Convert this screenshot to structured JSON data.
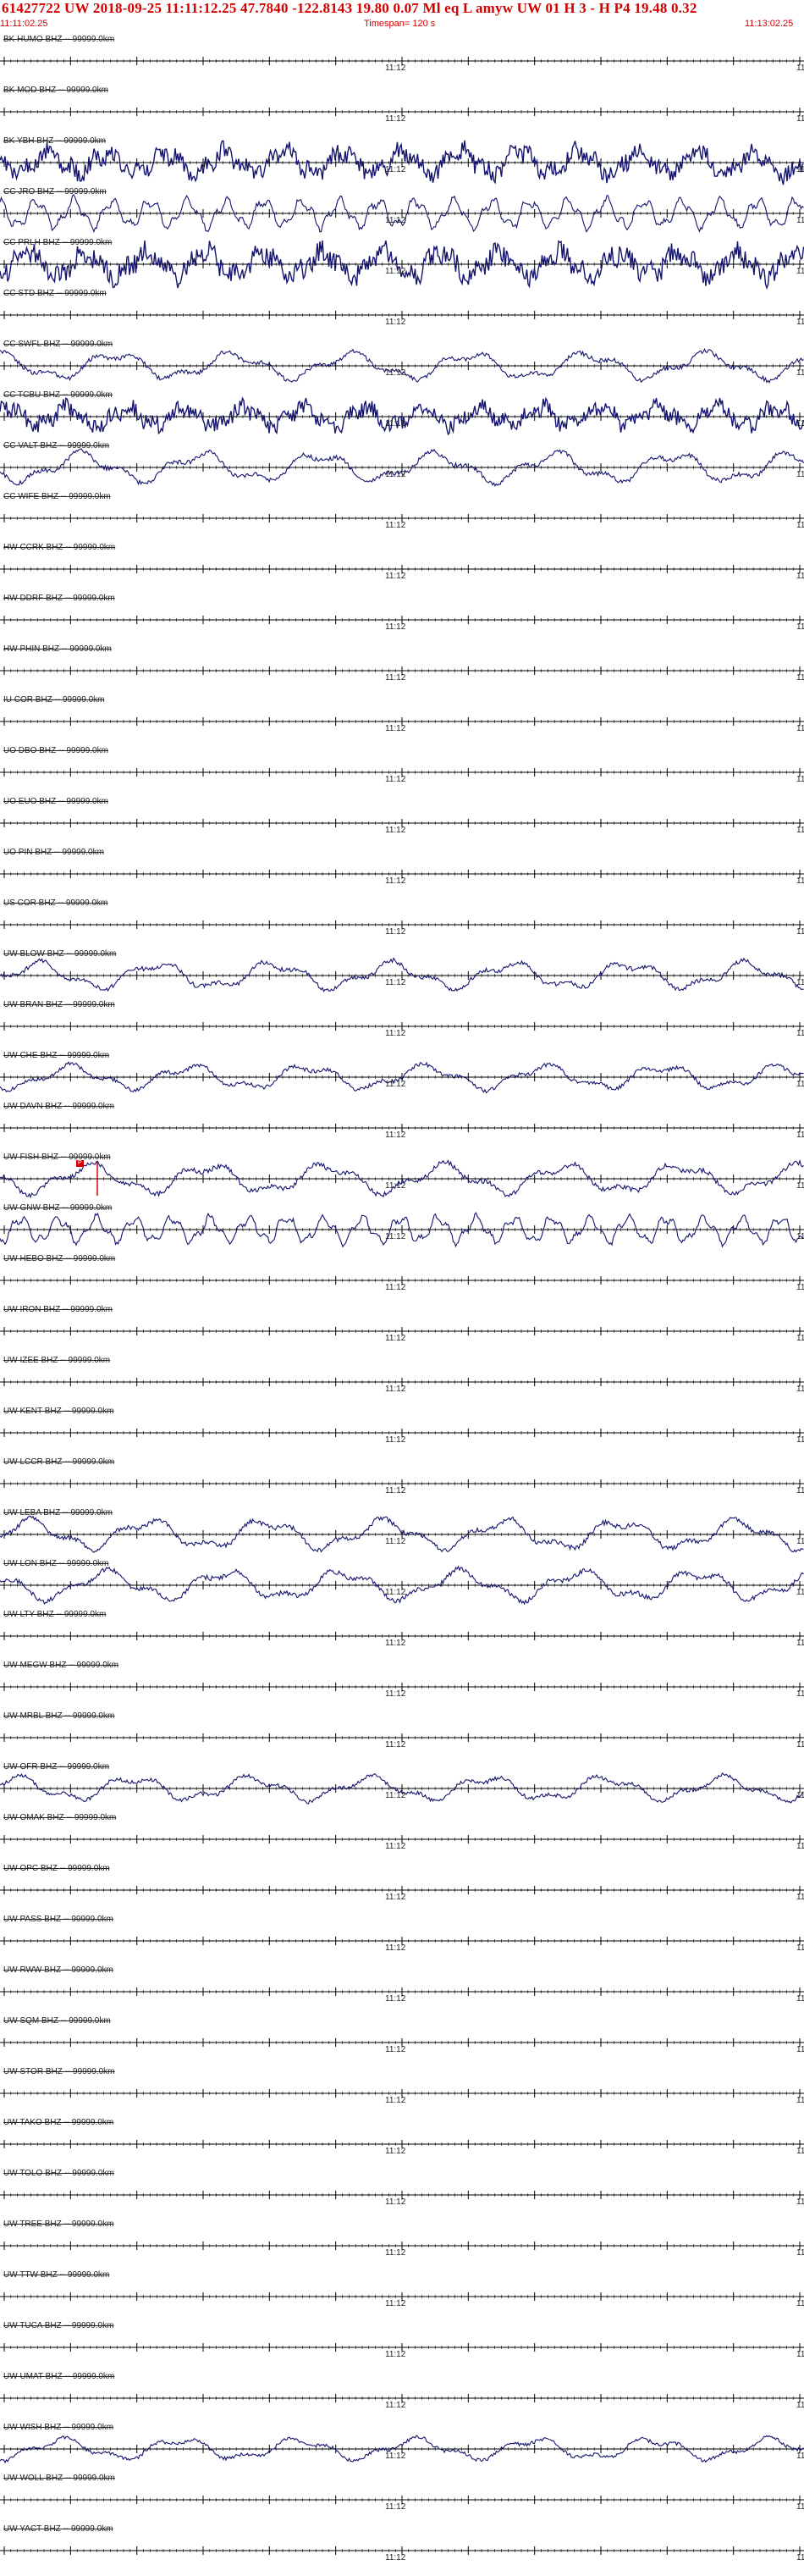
{
  "header": {
    "line1": "61427722 UW 2018-09-25 11:11:12.25   47.7840 -122.8143  19.80  0.07 Ml  eq  L amyw     UW 01  H   3  -  H P4   19.48  0.32",
    "start_time": "11:11:02.25",
    "timespan": "Timespan= 120 s",
    "end_time": "11:13:02.25"
  },
  "time_mark": "11:12",
  "time_mark_edge": "11",
  "colors": {
    "header_text": "#d40000",
    "trace": "#14146e",
    "axis": "#000000",
    "pick": "#d40000"
  },
  "stations": [
    {
      "label": "BK HUMO BHZ -- 99999.0km",
      "amp": 0
    },
    {
      "label": "BK MOD BHZ -- 99999.0km",
      "amp": 0
    },
    {
      "label": "BK YBH BHZ -- 99999.0km",
      "amp": 18,
      "kind": "noise"
    },
    {
      "label": "CC JRO BHZ -- 99999.0km",
      "amp": 22,
      "kind": "osc"
    },
    {
      "label": "CC PRLH BHZ -- 99999.0km",
      "amp": 20,
      "kind": "noise"
    },
    {
      "label": "CC STD BHZ -- 99999.0km",
      "amp": 0
    },
    {
      "label": "CC SWFL BHZ -- 99999.0km",
      "amp": 20,
      "kind": "swell"
    },
    {
      "label": "CC TCBU BHZ -- 99999.0km",
      "amp": 16,
      "kind": "noise"
    },
    {
      "label": "CC VALT BHZ -- 99999.0km",
      "amp": 22,
      "kind": "swell"
    },
    {
      "label": "CC WIFE BHZ -- 99999.0km",
      "amp": 0
    },
    {
      "label": "HW CCRK BHZ -- 99999.0km",
      "amp": 0
    },
    {
      "label": "HW DDRF BHZ -- 99999.0km",
      "amp": 0
    },
    {
      "label": "HW PHIN BHZ -- 99999.0km",
      "amp": 0
    },
    {
      "label": "IU COR BHZ -- 99999.0km",
      "amp": 0
    },
    {
      "label": "UO DBO BHZ -- 99999.0km",
      "amp": 0
    },
    {
      "label": "UO EUO BHZ -- 99999.0km",
      "amp": 0
    },
    {
      "label": "UO PIN BHZ -- 99999.0km",
      "amp": 0
    },
    {
      "label": "US COR BHZ -- 99999.0km",
      "amp": 0
    },
    {
      "label": "UW BLOW BHZ -- 99999.0km",
      "amp": 20,
      "kind": "swell"
    },
    {
      "label": "UW BRAN BHZ -- 99999.0km",
      "amp": 0
    },
    {
      "label": "UW CHE BHZ -- 99999.0km",
      "amp": 18,
      "kind": "swell"
    },
    {
      "label": "UW DAVN BHZ -- 99999.0km",
      "amp": 0
    },
    {
      "label": "UW FISH BHZ -- 99999.0km",
      "amp": 22,
      "kind": "swell",
      "pick": "P"
    },
    {
      "label": "UW GNW BHZ -- 99999.0km",
      "amp": 20,
      "kind": "osc"
    },
    {
      "label": "UW HEBO BHZ -- 99999.0km",
      "amp": 0
    },
    {
      "label": "UW IRON BHZ -- 99999.0km",
      "amp": 0
    },
    {
      "label": "UW IZEE BHZ -- 99999.0km",
      "amp": 0
    },
    {
      "label": "UW KENT BHZ -- 99999.0km",
      "amp": 0
    },
    {
      "label": "UW LCCR BHZ -- 99999.0km",
      "amp": 0
    },
    {
      "label": "UW LEBA BHZ -- 99999.0km",
      "amp": 22,
      "kind": "swell"
    },
    {
      "label": "UW LON BHZ -- 99999.0km",
      "amp": 22,
      "kind": "swell"
    },
    {
      "label": "UW LTY BHZ -- 99999.0km",
      "amp": 0
    },
    {
      "label": "UW MEGW BHZ -- 99999.0km",
      "amp": 0
    },
    {
      "label": "UW MRBL BHZ -- 99999.0km",
      "amp": 0
    },
    {
      "label": "UW OFR BHZ -- 99999.0km",
      "amp": 18,
      "kind": "swell"
    },
    {
      "label": "UW OMAK BHZ -- 99999.0km",
      "amp": 0
    },
    {
      "label": "UW OPC BHZ -- 99999.0km",
      "amp": 0
    },
    {
      "label": "UW PASS BHZ -- 99999.0km",
      "amp": 0
    },
    {
      "label": "UW RWW BHZ -- 99999.0km",
      "amp": 0
    },
    {
      "label": "UW SQM BHZ -- 99999.0km",
      "amp": 0
    },
    {
      "label": "UW STOR BHZ -- 99999.0km",
      "amp": 0
    },
    {
      "label": "UW TAKO BHZ -- 99999.0km",
      "amp": 0
    },
    {
      "label": "UW TOLO BHZ -- 99999.0km",
      "amp": 0
    },
    {
      "label": "UW TREE BHZ -- 99999.0km",
      "amp": 0
    },
    {
      "label": "UW TTW BHZ -- 99999.0km",
      "amp": 0
    },
    {
      "label": "UW TUCA BHZ -- 99999.0km",
      "amp": 0
    },
    {
      "label": "UW UMAT BHZ -- 99999.0km",
      "amp": 0
    },
    {
      "label": "UW WISH BHZ -- 99999.0km",
      "amp": 16,
      "kind": "swell"
    },
    {
      "label": "UW WOLL BHZ -- 99999.0km",
      "amp": 0
    },
    {
      "label": "UW YACT BHZ -- 99999.0km",
      "amp": 0
    }
  ]
}
